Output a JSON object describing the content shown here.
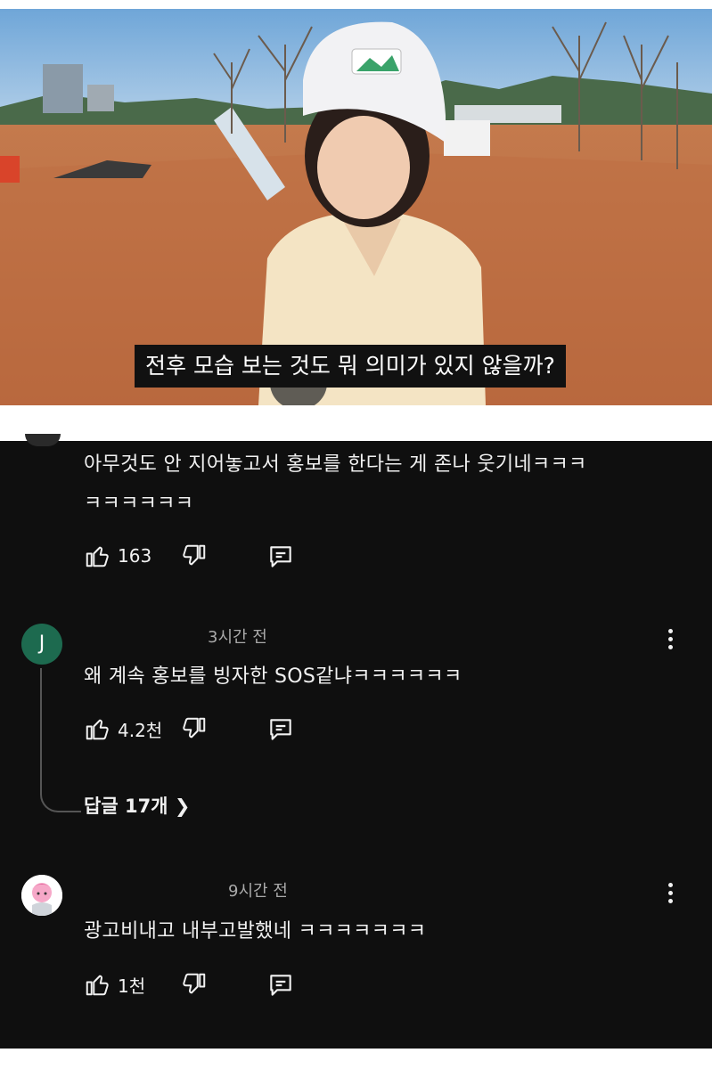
{
  "video": {
    "subtitle": "전후 모습 보는 것도 뭐 의미가 있지 않을까?"
  },
  "comments": [
    {
      "text_line1": "아무것도 안 지어놓고서 홍보를 한다는 게 존나 웃기네ㅋㅋㅋ",
      "text_line2": "ㅋㅋㅋㅋㅋㅋ",
      "likes": "163"
    },
    {
      "avatar_letter": "J",
      "time": "3시간 전",
      "text": "왜 계속 홍보를 빙자한 SOS같냐ㅋㅋㅋㅋㅋㅋ",
      "likes": "4.2천",
      "replies": "답글 17개"
    },
    {
      "time": "9시간 전",
      "text": "광고비내고 내부고발했네 ㅋㅋㅋㅋㅋㅋㅋ",
      "likes": "1천"
    }
  ],
  "icons": {
    "like": "thumbs-up-icon",
    "dislike": "thumbs-down-icon",
    "reply": "comment-icon",
    "more": "more-vert-icon"
  },
  "colors": {
    "background": "#0f0f0f",
    "text": "#f1f1f1",
    "secondary_text": "#aaaaaa",
    "avatar_j": "#1d6a4f"
  }
}
